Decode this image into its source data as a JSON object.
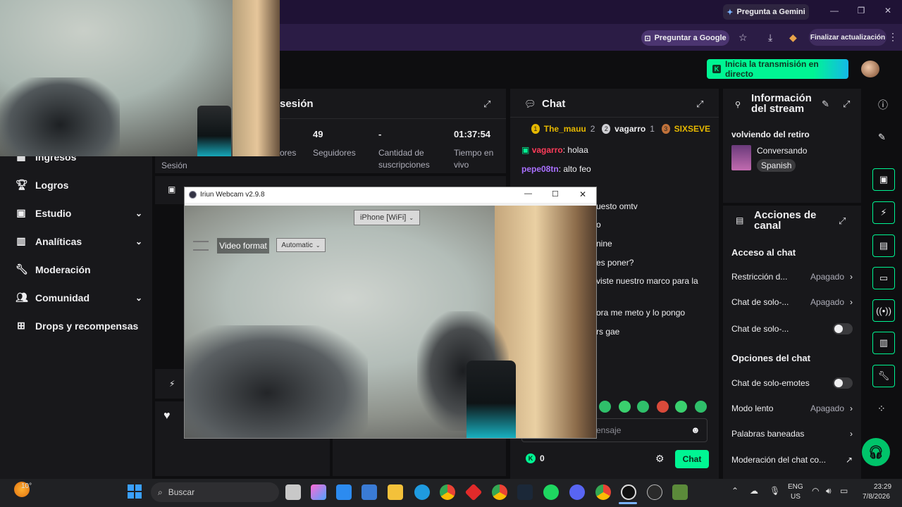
{
  "browser": {
    "gemini_label": "Pregunta a Gemini",
    "ask_google_label": "Preguntar a Google",
    "update_label": "Finalizar actualización"
  },
  "header": {
    "go_live_label": "Inicia la transmisión en directo"
  },
  "nav": {
    "items": [
      {
        "label": "Ingresos",
        "icon": "ingresos-icon"
      },
      {
        "label": "Logros",
        "icon": "trophy-icon"
      },
      {
        "label": "Estudio",
        "icon": "studio-icon"
      },
      {
        "label": "Analíticas",
        "icon": "chart-icon"
      },
      {
        "label": "Moderación",
        "icon": "wrench-icon"
      },
      {
        "label": "Comunidad",
        "icon": "people-icon"
      },
      {
        "label": "Drops y recompensas",
        "icon": "drops-icon"
      }
    ]
  },
  "session": {
    "title_fragment": "sesión",
    "stats": [
      {
        "value": "",
        "label": "Sesión"
      },
      {
        "value": "",
        "label": "ores"
      },
      {
        "value": "49",
        "label": "Seguidores"
      },
      {
        "value": "-",
        "label": "Cantidad de suscripciones"
      },
      {
        "value": "01:37:54",
        "label": "Tiempo en vivo"
      }
    ]
  },
  "chat": {
    "title": "Chat",
    "top_chatters": [
      {
        "rank": "1",
        "name": "The_mauu",
        "count": "2"
      },
      {
        "rank": "2",
        "name": "vagarro",
        "count": "1"
      },
      {
        "rank": "3",
        "name": "SIXSEVE",
        "count": ""
      }
    ],
    "messages": [
      {
        "user": "vagarro",
        "text": "holaa",
        "color": "#ff3c5a"
      },
      {
        "user": "pepe08tn",
        "text": "alto feo",
        "color": "#a970ff"
      },
      {
        "user": "",
        "text": "uesto omtv",
        "color": "#a970ff"
      },
      {
        "user": "",
        "text": "o",
        "color": "#a970ff"
      },
      {
        "user": "",
        "text": "nine",
        "color": "#a970ff"
      },
      {
        "user": "",
        "text": "es poner?",
        "color": "#a970ff"
      },
      {
        "user": "",
        "text": "viste nuestro marco para la",
        "color": "#a970ff"
      },
      {
        "user": "",
        "text": "ora me meto y lo pongo",
        "color": "#a970ff"
      },
      {
        "user": "",
        "text": "rs gae",
        "color": "#a970ff"
      }
    ],
    "input_placeholder": "ensaje",
    "points": "0",
    "send_label": "Chat"
  },
  "stream_info": {
    "title": "Información del stream",
    "stream_title": "volviendo del retiro",
    "category": "Conversando",
    "language": "Spanish"
  },
  "channel_actions": {
    "title": "Acciones de canal",
    "section_chat_access": "Acceso al chat",
    "rows_access": [
      {
        "label": "Restricción d...",
        "value": "Apagado",
        "kind": "chevron"
      },
      {
        "label": "Chat de solo-...",
        "value": "Apagado",
        "kind": "chevron"
      },
      {
        "label": "Chat de solo-...",
        "value": "",
        "kind": "toggle"
      }
    ],
    "section_chat_options": "Opciones del chat",
    "rows_options": [
      {
        "label": "Chat de solo-emotes",
        "value": "",
        "kind": "toggle"
      },
      {
        "label": "Modo lento",
        "value": "Apagado",
        "kind": "chevron"
      },
      {
        "label": "Palabras baneadas",
        "value": "",
        "kind": "chevron"
      },
      {
        "label": "Moderación del chat co...",
        "value": "",
        "kind": "external"
      }
    ]
  },
  "iriun": {
    "window_title": "Iriun Webcam v2.9.8",
    "device_select": "iPhone [WiFi]",
    "video_format_label": "Video format",
    "video_format_value": "Automatic"
  },
  "taskbar": {
    "weather": "10°",
    "search_placeholder": "Buscar",
    "lang_top": "ENG",
    "lang_bottom": "US",
    "time": "23:29",
    "date": "7/8/2026"
  },
  "colors": {
    "accent": "#00f593",
    "panel": "#18181b",
    "background": "#0e0e10",
    "browser_frame": "#1f1235"
  }
}
